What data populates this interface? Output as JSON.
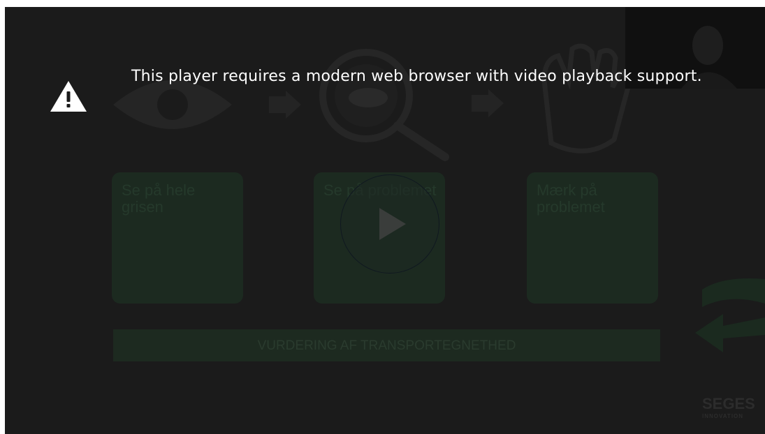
{
  "overlay": {
    "message": "This player requires a modern web browser with video playback support.",
    "icon": "warning-icon"
  },
  "slide": {
    "cards": [
      {
        "label": "Se på hele grisen"
      },
      {
        "label": "Se på problemet"
      },
      {
        "label": "Mærk på problemet"
      }
    ],
    "banner": "VURDERING AF TRANSPORTEGNETHED",
    "icons": [
      "eye-icon",
      "arrow-right-icon",
      "magnifier-pig-icon",
      "arrow-right-icon",
      "hand-icon",
      "return-arrow-icon"
    ]
  },
  "logo": {
    "main": "SEGES",
    "sub": "INNOVATION"
  },
  "colors": {
    "background": "#1b1b1b",
    "card": "#1c2a20",
    "text": "#ffffff"
  }
}
